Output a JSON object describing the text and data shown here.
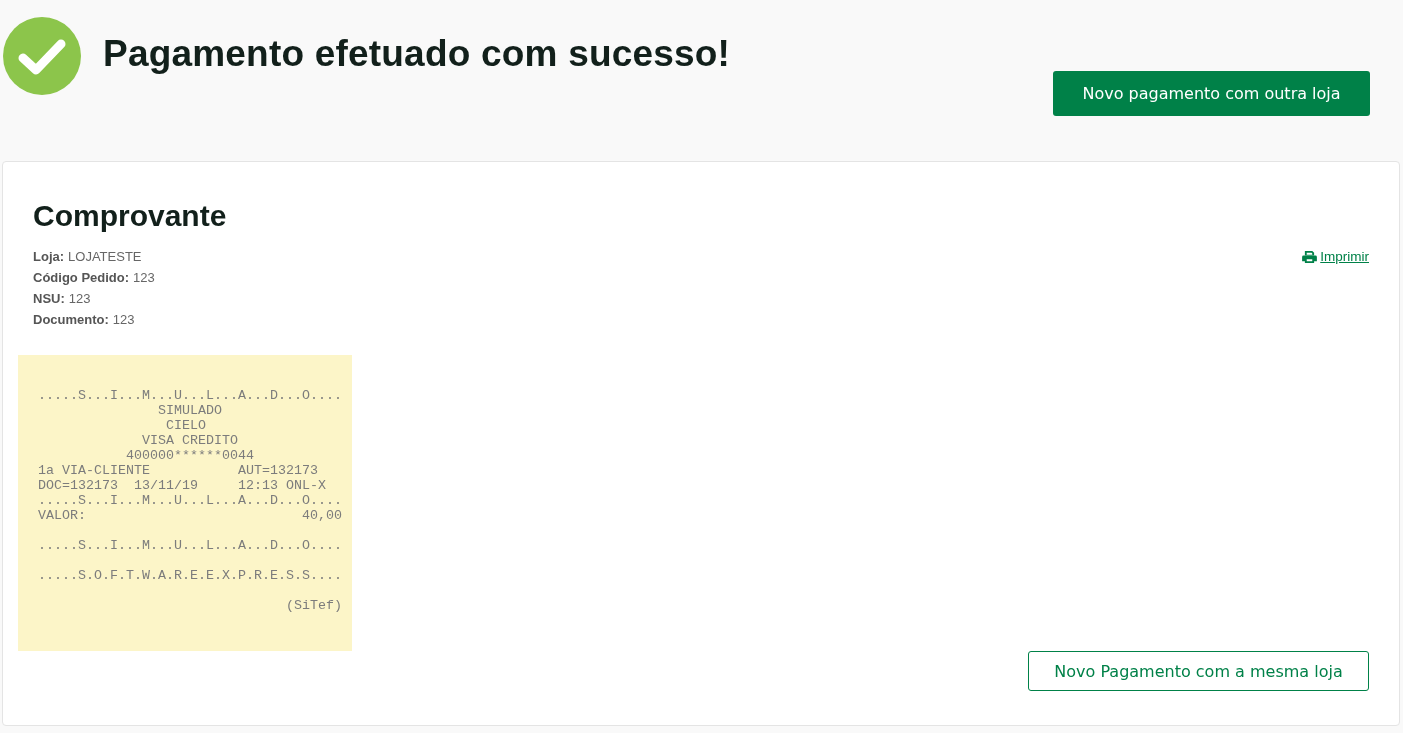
{
  "header": {
    "title": "Pagamento efetuado com sucesso!",
    "button": "Novo pagamento com outra loja"
  },
  "receipt_card": {
    "title": "Comprovante",
    "fields": [
      {
        "label": "Loja:",
        "value": "LOJATESTE"
      },
      {
        "label": "Código Pedido:",
        "value": "123"
      },
      {
        "label": "NSU:",
        "value": "123"
      },
      {
        "label": "Documento:",
        "value": "123"
      }
    ],
    "print_link": "Imprimir",
    "receipt_text": ".....S...I...M...U...L...A...D...O....\n               SIMULADO\n                CIELO\n             VISA CREDITO\n           400000******0044\n1a VIA-CLIENTE           AUT=132173\nDOC=132173  13/11/19     12:13 ONL-X\n.....S...I...M...U...L...A...D...O....\nVALOR:                           40,00\n\n.....S...I...M...U...L...A...D...O....\n\n.....S.O.F.T.W.A.R.E.E.X.P.R.E.S.S....\n\n                               (SiTef)",
    "button": "Novo Pagamento com a mesma loja"
  }
}
